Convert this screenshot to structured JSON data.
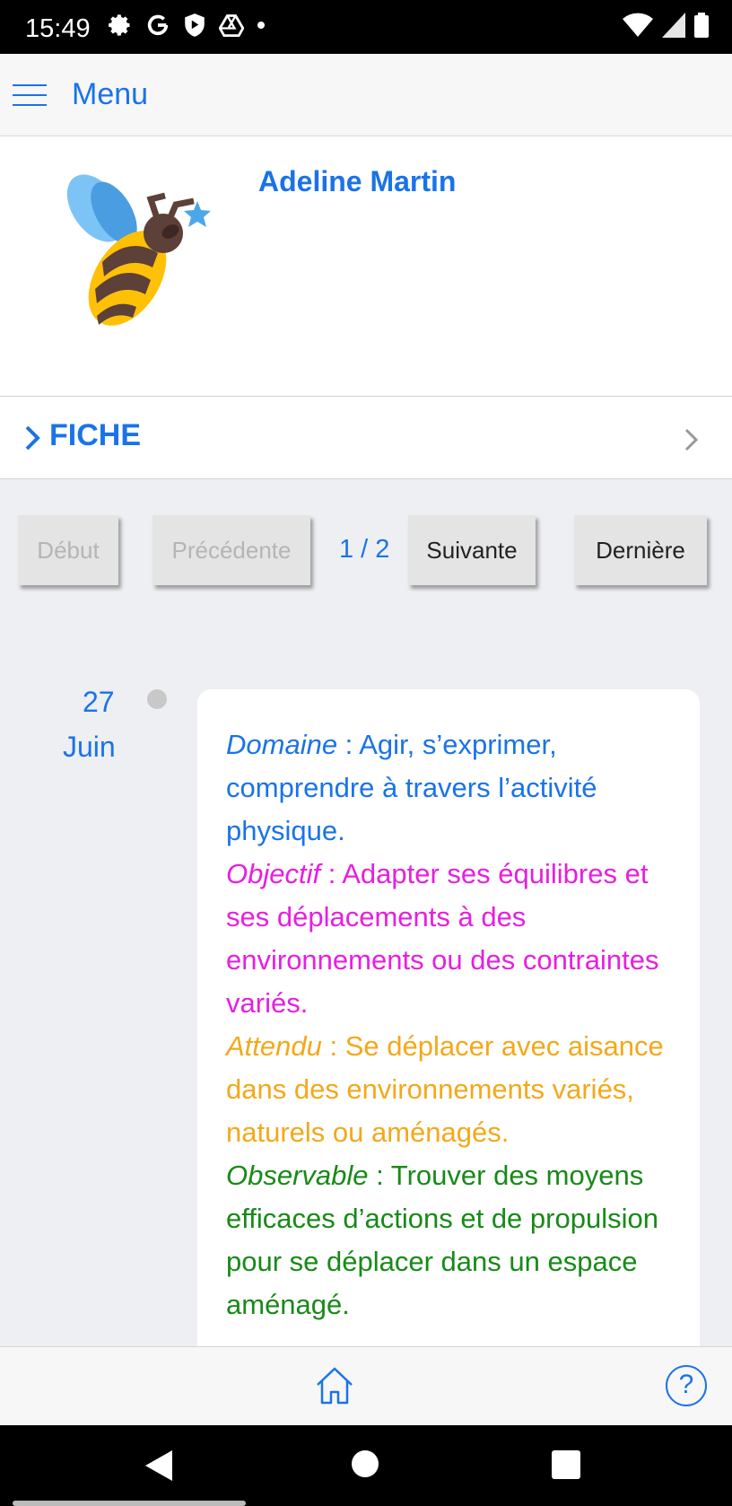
{
  "status_bar": {
    "time": "15:49",
    "left_icons": [
      "gear-icon",
      "google-icon",
      "shield-play-icon",
      "drive-icon",
      "dot-icon"
    ],
    "right_icons": [
      "wifi-icon",
      "signal-icon",
      "battery-icon"
    ]
  },
  "header": {
    "menu_label": "Menu"
  },
  "profile": {
    "name": "Adeline Martin",
    "avatar": "bee-star-icon"
  },
  "fiche": {
    "label": "FICHE"
  },
  "pager": {
    "first_label": "Début",
    "prev_label": "Précédente",
    "count": "1 / 2",
    "next_label": "Suivante",
    "last_label": "Dernière"
  },
  "entry": {
    "day": "27",
    "month": "Juin",
    "domaine_label": "Domaine",
    "domaine_text": " : Agir, s’exprimer, comprendre à travers l’activité physique.",
    "objectif_label": "Objectif",
    "objectif_text": " : Adapter ses équilibres et ses déplacements à des environnements ou des contraintes variés.",
    "attendu_label": "Attendu",
    "attendu_text": " : Se déplacer avec aisance dans des environnements variés, naturels ou aménagés.",
    "observable_label": "Observable",
    "observable_text": " : Trouver des moyens efficaces d’actions et de propulsion pour se déplacer dans un espace aménagé."
  },
  "colors": {
    "accent": "#1a73e8",
    "domaine": "#1a73e8",
    "objectif": "#e81ee0",
    "attendu": "#f4a81a",
    "observable": "#178a17"
  },
  "bottom_bar": {
    "home_icon": "home-icon",
    "help_icon": "help-icon",
    "help_symbol": "?"
  }
}
